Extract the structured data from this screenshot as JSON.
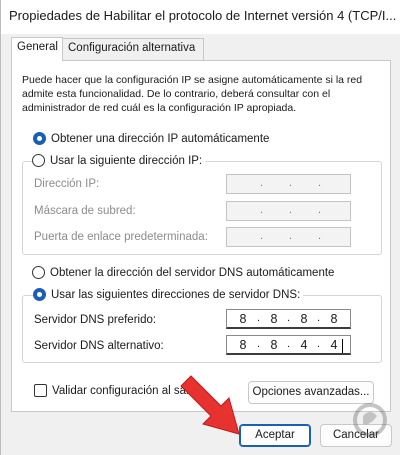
{
  "window": {
    "title": "Propiedades de Habilitar el protocolo de Internet versión 4 (TCP/I..."
  },
  "tabs": [
    {
      "label": "General",
      "active": true
    },
    {
      "label": "Configuración alternativa",
      "active": false
    }
  ],
  "description": "Puede hacer que la configuración IP se asigne automáticamente si la red admite esta funcionalidad. De lo contrario, deberá consultar con el administrador de red cuál es la configuración IP apropiada.",
  "ip": {
    "auto_label": "Obtener una dirección IP automáticamente",
    "auto_selected": true,
    "manual_label": "Usar la siguiente dirección IP:",
    "manual_selected": false,
    "fields": [
      {
        "label": "Dirección IP:"
      },
      {
        "label": "Máscara de subred:"
      },
      {
        "label": "Puerta de enlace predeterminada:"
      }
    ]
  },
  "dns": {
    "auto_label": "Obtener la dirección del servidor DNS automáticamente",
    "auto_selected": false,
    "manual_label": "Usar las siguientes direcciones de servidor DNS:",
    "manual_selected": true,
    "preferred_label": "Servidor DNS preferido:",
    "preferred_octets": [
      "8",
      "8",
      "8",
      "8"
    ],
    "alternate_label": "Servidor DNS alternativo:",
    "alternate_octets": [
      "8",
      "8",
      "4",
      "4"
    ]
  },
  "validate": {
    "label": "Validar configuración al sali",
    "checked": false
  },
  "buttons": {
    "advanced": "Opciones avanzadas...",
    "accept": "Aceptar",
    "cancel": "Cancelar"
  },
  "annotation": {
    "arrow_color": "#e8322f"
  },
  "watermark": {
    "text": "SOLVETIC.COM"
  }
}
